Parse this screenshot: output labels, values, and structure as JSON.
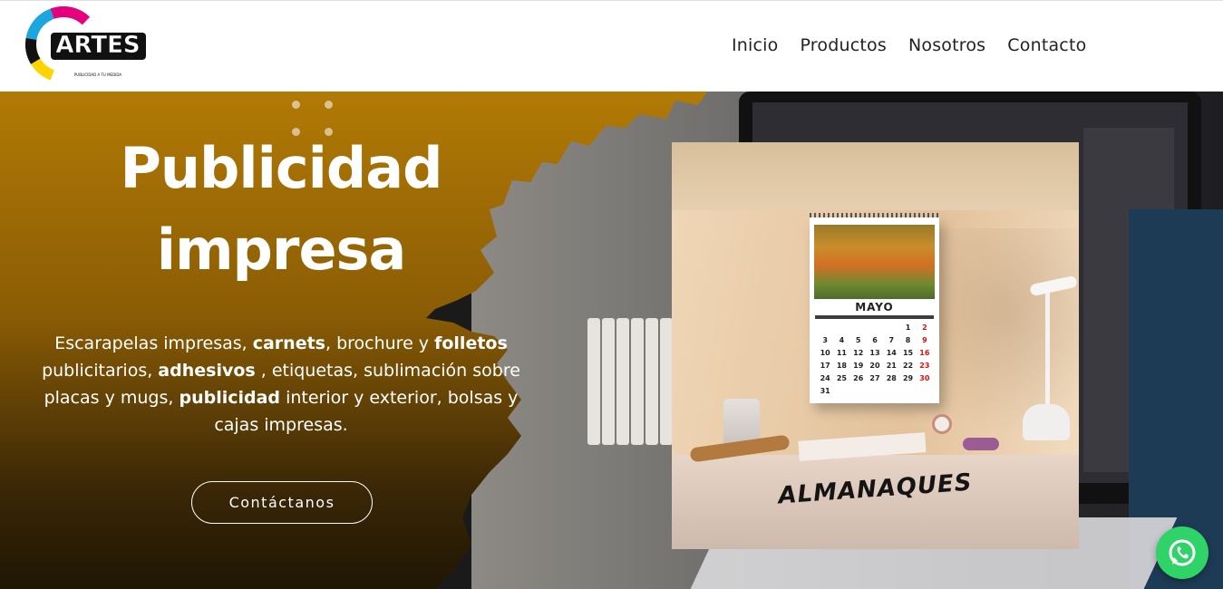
{
  "header": {
    "logo": {
      "line1": "ARTES",
      "line2": "PUBLICITARIAS",
      "tagline": "PUBLICIDAD A TU MEDIDA"
    },
    "nav": [
      {
        "label": "Inicio"
      },
      {
        "label": "Productos"
      },
      {
        "label": "Nosotros"
      },
      {
        "label": "Contacto"
      }
    ]
  },
  "hero": {
    "title_line1": "Publicidad",
    "title_line2": "impresa",
    "description_parts": [
      {
        "text": "Escarapelas impresas, ",
        "bold": false
      },
      {
        "text": "carnets",
        "bold": true
      },
      {
        "text": ", brochure y ",
        "bold": false
      },
      {
        "text": "folletos",
        "bold": true
      },
      {
        "text": " publicitarios, ",
        "bold": false
      },
      {
        "text": "adhesivos",
        "bold": true
      },
      {
        "text": " , etiquetas, sublimación sobre placas y mugs, ",
        "bold": false
      },
      {
        "text": "publicidad",
        "bold": true
      },
      {
        "text": " interior y exterior, bolsas y cajas impresas.",
        "bold": false
      }
    ],
    "cta_label": "Contáctanos"
  },
  "product_card": {
    "label": "ALMANAQUES",
    "calendar": {
      "month": "MAYO",
      "days": [
        "",
        "",
        "",
        "",
        "",
        "1",
        "2",
        "3",
        "4",
        "5",
        "6",
        "7",
        "8",
        "9",
        "10",
        "11",
        "12",
        "13",
        "14",
        "15",
        "16",
        "17",
        "18",
        "19",
        "20",
        "21",
        "22",
        "23",
        "24",
        "25",
        "26",
        "27",
        "28",
        "29",
        "30",
        "31",
        "",
        "",
        "",
        "",
        "",
        ""
      ]
    }
  },
  "colors": {
    "brand_gold": "#b27a05",
    "whatsapp_green": "#2fd367",
    "text_white": "#ffffff",
    "nav_text": "#222222"
  },
  "icons": {
    "whatsapp": "whatsapp-icon"
  }
}
